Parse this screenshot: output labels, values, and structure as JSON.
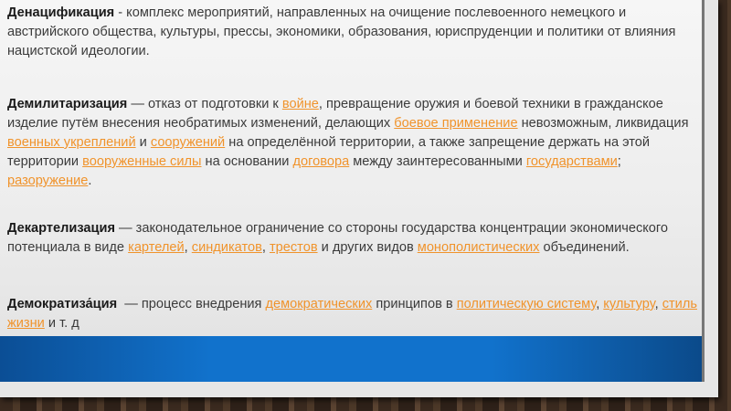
{
  "p1": {
    "term": "Денацификация",
    "text": " - комплекс мероприятий, направленных на очищение послевоенного немецкого и австрийского общества, культуры, прессы, экономики, образования, юриспруденции и политики от влияния нацистской идеологии."
  },
  "p2": {
    "term": "Демилитаризация",
    "t1": " — отказ от подготовки к ",
    "l1": "войне",
    "t2": ", превращение оружия и боевой техники в гражданское изделие путём внесения необратимых изменений, делающих ",
    "l2": "боевое применение",
    "t3": " невозможным, ликвидация ",
    "l3": "военных укреплений",
    "t4": " и ",
    "l4": "сооружений",
    "t5": " на определённой территории, а также запрещение держать на этой территории ",
    "l5": "вооруженные силы",
    "t6": " на основании ",
    "l6": "договора",
    "t7": " между заинтересованными ",
    "l7": "государствами",
    "t8": "; ",
    "l8": "разоружение",
    "t9": "."
  },
  "p3": {
    "term": "Декартелизация",
    "t1": " — законодательное ограничение со стороны государства концентрации экономического потенциала в виде ",
    "l1": "картелей",
    "t2": ", ",
    "l2": "синдикатов",
    "t3": ", ",
    "l3": "трестов",
    "t4": " и других видов ",
    "l4": "монополистических",
    "t5": " объединений."
  },
  "p4": {
    "term": "Демократиза́ция",
    "t1": "  — процесс внедрения ",
    "l1": "демократических",
    "t2": " принципов в ",
    "l2": "политическую систему",
    "t3": ", ",
    "l3": "культуру",
    "t4": ", ",
    "l4": "стиль жизни",
    "t5": " и т. д"
  },
  "colors": {
    "link": "#f0932b",
    "band": "#1172cc"
  }
}
